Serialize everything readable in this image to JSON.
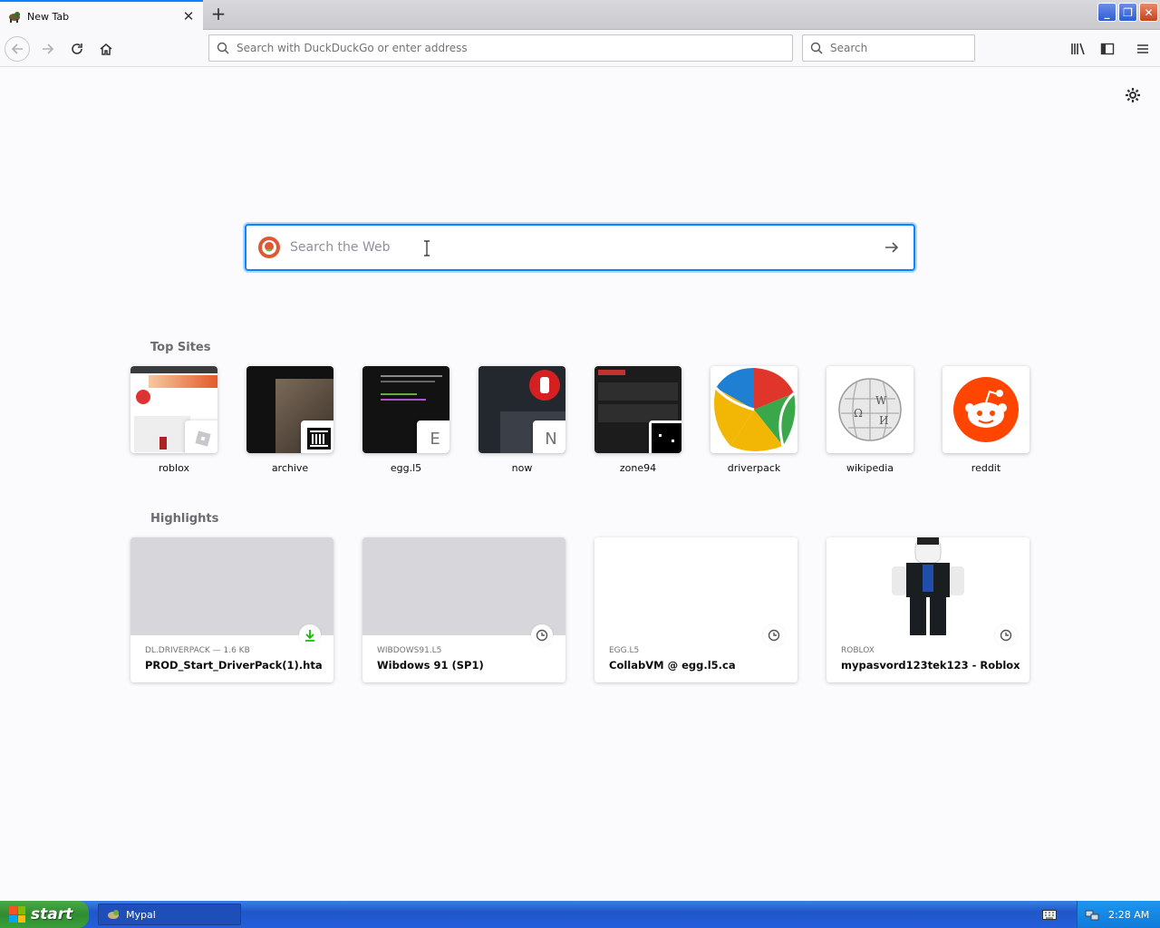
{
  "tab": {
    "title": "New Tab"
  },
  "navbar": {
    "url_placeholder": "Search with DuckDuckGo or enter address",
    "search_placeholder": "Search"
  },
  "main": {
    "search_placeholder": "Search the Web",
    "top_sites_title": "Top Sites",
    "top_sites": [
      {
        "label": "roblox"
      },
      {
        "label": "archive"
      },
      {
        "label": "egg.l5",
        "badge": "E"
      },
      {
        "label": "now",
        "badge": "N"
      },
      {
        "label": "zone94"
      },
      {
        "label": "driverpack"
      },
      {
        "label": "wikipedia"
      },
      {
        "label": "reddit"
      }
    ],
    "highlights_title": "Highlights",
    "highlights": [
      {
        "meta": "DL.DRIVERPACK — 1.6 KB",
        "title": "PROD_Start_DriverPack(1).hta",
        "icon": "download-icon"
      },
      {
        "meta": "WIBDOWS91.L5",
        "title": "Wibdows 91 (SP1)",
        "icon": "clock-icon"
      },
      {
        "meta": "EGG.L5",
        "title": "CollabVM @ egg.l5.ca",
        "icon": "clock-icon"
      },
      {
        "meta": "ROBLOX",
        "title": "mypasvord123tek123 - Roblox",
        "icon": "clock-icon"
      }
    ]
  },
  "taskbar": {
    "start_label": "start",
    "task_label": "Mypal",
    "clock": "2:28 AM"
  },
  "colors": {
    "accent": "#0a84ff",
    "reddit": "#ff4500",
    "download": "#12bc00"
  }
}
